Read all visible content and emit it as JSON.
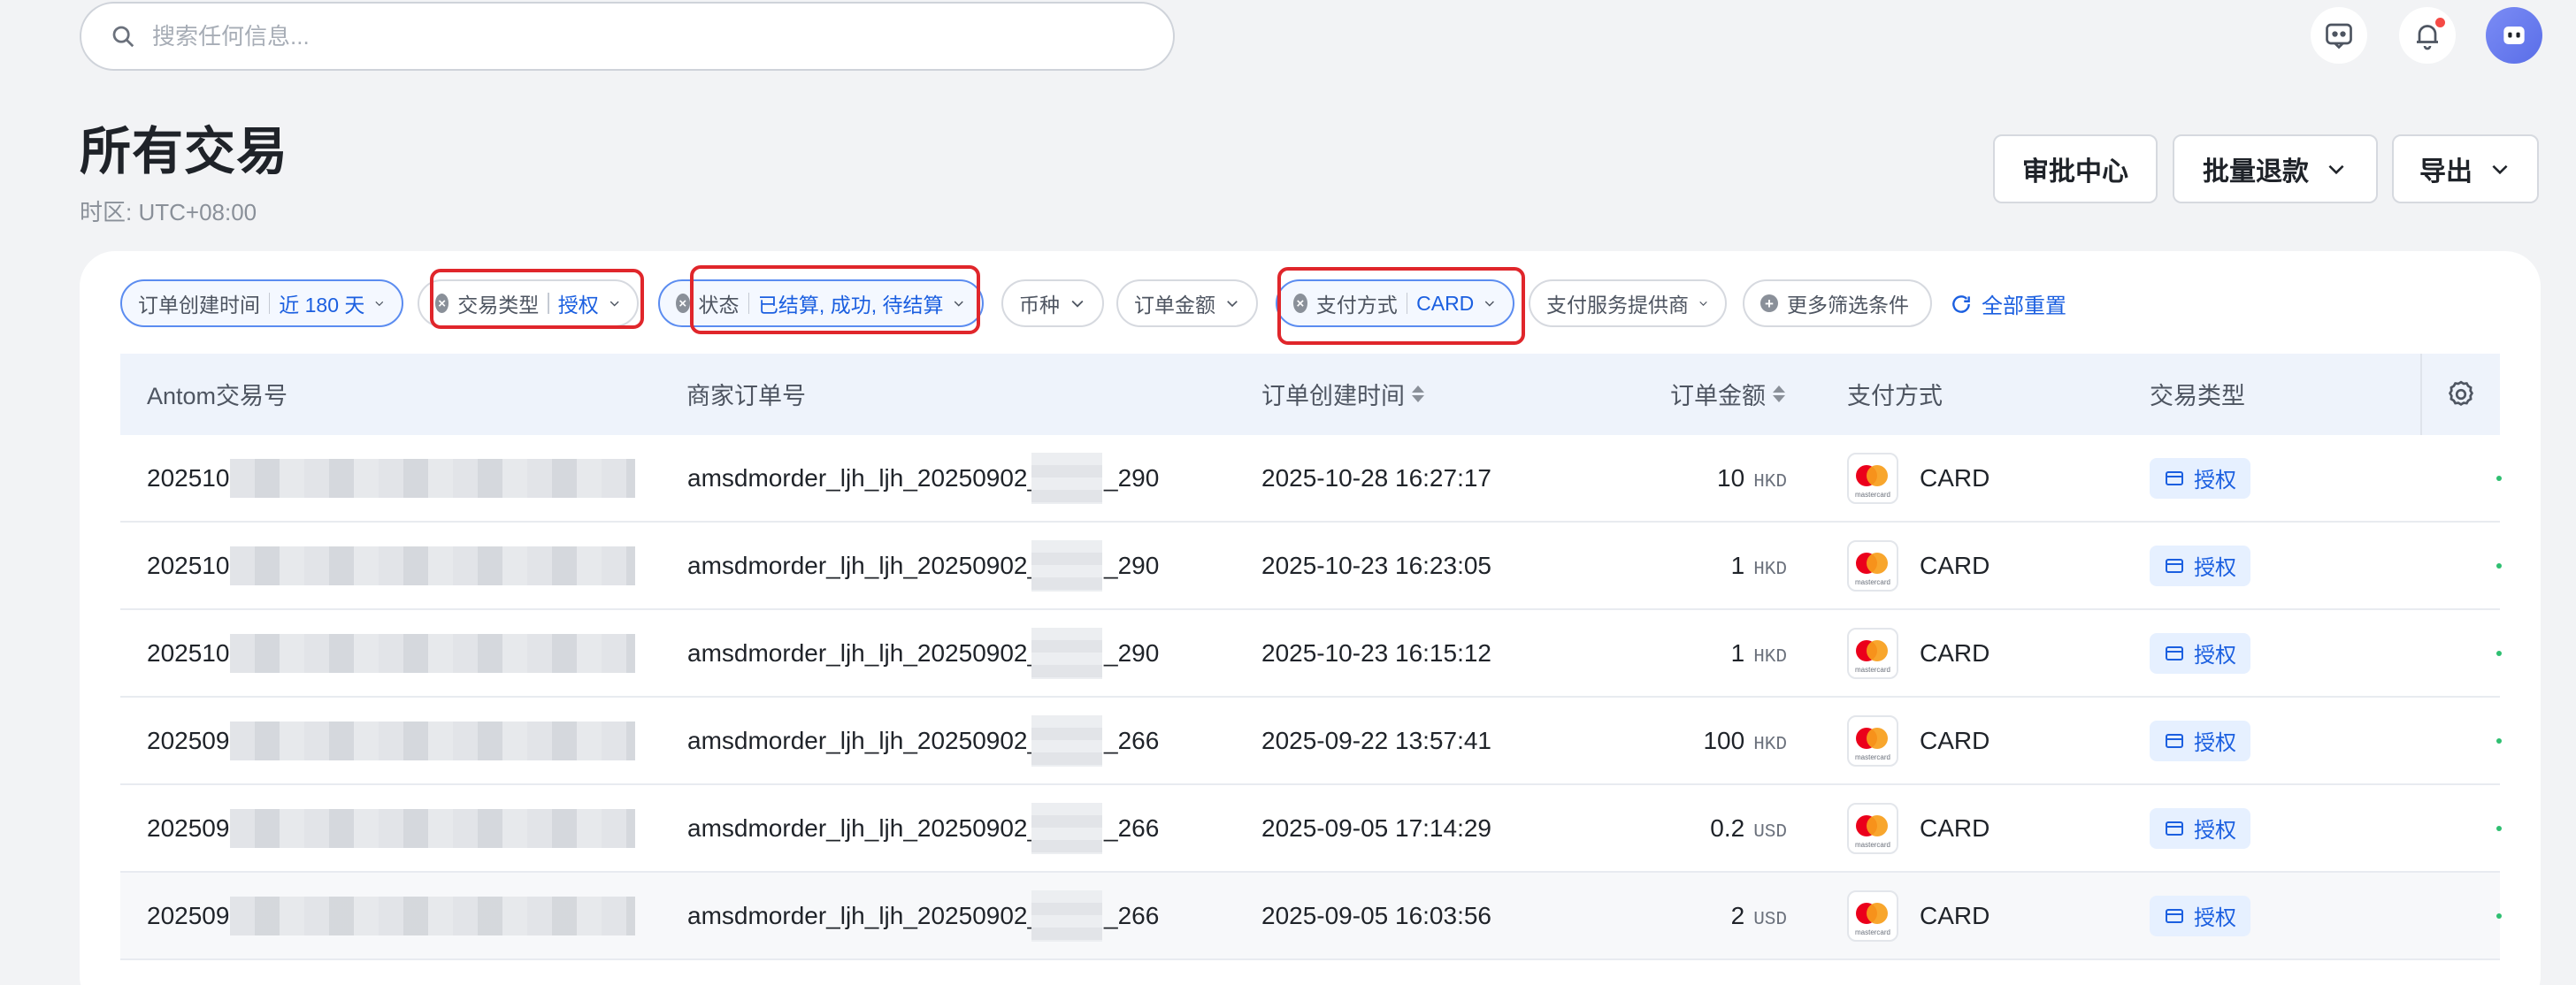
{
  "search": {
    "placeholder": "搜索任何信息..."
  },
  "header": {
    "title": "所有交易",
    "timezone": "时区: UTC+08:00",
    "approval_label": "审批中心",
    "batch_refund_label": "批量退款",
    "export_label": "导出"
  },
  "filters": [
    {
      "label": "订单创建时间",
      "value": "近 180 天",
      "active": true,
      "highlighted": false
    },
    {
      "label": "交易类型",
      "value": "授权",
      "active": false,
      "highlighted": true
    },
    {
      "label": "状态",
      "value": "已结算, 成功, 待结算",
      "active": true,
      "highlighted": true
    },
    {
      "label": "币种",
      "value": "",
      "active": false,
      "highlighted": false
    },
    {
      "label": "订单金额",
      "value": "",
      "active": false,
      "highlighted": false
    },
    {
      "label": "支付方式",
      "value": "CARD",
      "active": true,
      "highlighted": true
    },
    {
      "label": "支付服务提供商",
      "value": "",
      "active": false,
      "highlighted": false
    }
  ],
  "more_filters_label": "更多筛选条件",
  "reset_label": "全部重置",
  "table": {
    "columns": [
      "Antom交易号",
      "商家订单号",
      "订单创建时间",
      "订单金额",
      "支付方式",
      "交易类型"
    ],
    "rows": [
      {
        "txn_prefix": "202510",
        "order_start": "amsdmorder_ljh_ljh_20250902_17",
        "order_end": "_290",
        "created": "2025-10-28 16:27:17",
        "amount": "10",
        "currency": "HKD",
        "method": "CARD",
        "type": "授权"
      },
      {
        "txn_prefix": "202510",
        "order_start": "amsdmorder_ljh_ljh_20250902_1",
        "order_end": "_290",
        "created": "2025-10-23 16:23:05",
        "amount": "1",
        "currency": "HKD",
        "method": "CARD",
        "type": "授权"
      },
      {
        "txn_prefix": "202510",
        "order_start": "amsdmorder_ljh_ljh_20250902_1",
        "order_end": "_290",
        "created": "2025-10-23 16:15:12",
        "amount": "1",
        "currency": "HKD",
        "method": "CARD",
        "type": "授权"
      },
      {
        "txn_prefix": "202509",
        "order_start": "amsdmorder_ljh_ljh_20250902_1",
        "order_end": "_266",
        "created": "2025-09-22 13:57:41",
        "amount": "100",
        "currency": "HKD",
        "method": "CARD",
        "type": "授权"
      },
      {
        "txn_prefix": "202509",
        "order_start": "amsdmorder_ljh_ljh_20250902_1",
        "order_end": "_266",
        "created": "2025-09-05 17:14:29",
        "amount": "0.2",
        "currency": "USD",
        "method": "CARD",
        "type": "授权"
      },
      {
        "txn_prefix": "202509",
        "order_start": "amsdmorder_ljh_ljh_20250902_1",
        "order_end": "_266",
        "created": "2025-09-05 16:03:56",
        "amount": "2",
        "currency": "USD",
        "method": "CARD",
        "type": "授权"
      }
    ]
  },
  "mastercard_caption": "mastercard",
  "colors": {
    "accent": "#1b5fe0",
    "highlight": "#e0262b",
    "header_bg": "#eef3fb"
  }
}
